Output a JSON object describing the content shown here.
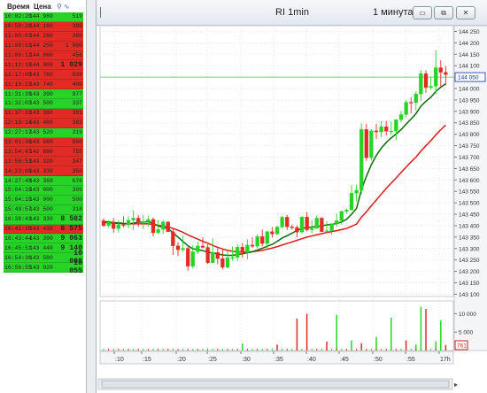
{
  "tape": {
    "header": {
      "time": "Время",
      "price": "Цена"
    },
    "rows": [
      {
        "time": "10:02:20",
        "price": "144 980",
        "qty": "519",
        "side": "buy"
      },
      {
        "time": "10:58:26",
        "price": "144 180",
        "qty": "398",
        "side": "sell"
      },
      {
        "time": "11:09:01",
        "price": "144 260",
        "qty": "380",
        "side": "sell"
      },
      {
        "time": "11:09:01",
        "price": "144 250",
        "qty": "1 000",
        "side": "sell"
      },
      {
        "time": "11:09:12",
        "price": "144 060",
        "qty": "456",
        "side": "sell"
      },
      {
        "time": "11:12:15",
        "price": "144 000",
        "qty": "1 029",
        "side": "sell",
        "big": true
      },
      {
        "time": "11:17:05",
        "price": "143 780",
        "qty": "839",
        "side": "sell"
      },
      {
        "time": "11:19:21",
        "price": "143 740",
        "qty": "409",
        "side": "sell"
      },
      {
        "time": "11:31:39",
        "price": "143 390",
        "qty": "977",
        "side": "buy"
      },
      {
        "time": "11:32:02",
        "price": "143 500",
        "qty": "337",
        "side": "buy"
      },
      {
        "time": "11:37:31",
        "price": "143 360",
        "qty": "381",
        "side": "sell"
      },
      {
        "time": "12:18:14",
        "price": "143 480",
        "qty": "383",
        "side": "sell"
      },
      {
        "time": "12:27:17",
        "price": "143 520",
        "qty": "319",
        "side": "buy"
      },
      {
        "time": "13:01:30",
        "price": "143 080",
        "qty": "500",
        "side": "sell"
      },
      {
        "time": "13:54:47",
        "price": "142 880",
        "qty": "755",
        "side": "sell"
      },
      {
        "time": "13:58:53",
        "price": "143 320",
        "qty": "347",
        "side": "sell"
      },
      {
        "time": "14:23:09",
        "price": "143 330",
        "qty": "350",
        "side": "sell"
      },
      {
        "time": "14:27:48",
        "price": "143 360",
        "qty": "676",
        "side": "buy"
      },
      {
        "time": "15:04:19",
        "price": "143 000",
        "qty": "305",
        "side": "buy"
      },
      {
        "time": "15:04:19",
        "price": "143 000",
        "qty": "500",
        "side": "buy"
      },
      {
        "time": "15:49:57",
        "price": "143 500",
        "qty": "318",
        "side": "buy"
      },
      {
        "time": "16:39:41",
        "price": "143 330",
        "qty": "8 582",
        "side": "buy",
        "big": true
      },
      {
        "time": "16:41:26",
        "price": "143 430",
        "qty": "8 575",
        "side": "sell",
        "big": true
      },
      {
        "time": "16:43:44",
        "price": "143 390",
        "qty": "9 063",
        "side": "buy",
        "big": true
      },
      {
        "time": "16:45:51",
        "price": "143 440",
        "qty": "9 140",
        "side": "buy",
        "big": true
      },
      {
        "time": "16:54:36",
        "price": "143 580",
        "qty": "10 008",
        "side": "buy",
        "big": true
      },
      {
        "time": "16:56:55",
        "price": "143 920",
        "qty": "10 055",
        "side": "buy",
        "big": true
      }
    ]
  },
  "window": {
    "title": "RI 1min",
    "timeframe": "1 минута",
    "buttons": {
      "minimize": "▭",
      "restore": "⧉",
      "close": "✕"
    }
  },
  "colors": {
    "buy": "#27d327",
    "sell": "#e22b25",
    "ma_fast": "#0b6b0b",
    "ma_slow": "#e01818",
    "last_line": "#33cc33"
  },
  "chart_data": {
    "type": "candlestick",
    "instrument": "RI",
    "ylim": [
      143090,
      144275
    ],
    "y_ticks": [
      "144 250",
      "144 200",
      "144 150",
      "144 100",
      "144 050",
      "144 000",
      "143 950",
      "143 900",
      "143 850",
      "143 800",
      "143 750",
      "143 700",
      "143 650",
      "143 600",
      "143 550",
      "143 500",
      "143 450",
      "143 400",
      "143 350",
      "143 300",
      "143 250",
      "143 200",
      "143 150",
      "143 100"
    ],
    "last_price": "144 050",
    "x_ticks": [
      ":10",
      ":15",
      ":20",
      ":25",
      ":30",
      ":35",
      ":40",
      ":45",
      ":50",
      ":55",
      "17h"
    ],
    "candles_ohlc": [
      [
        143422,
        143432,
        143394,
        143400
      ],
      [
        143400,
        143424,
        143391,
        143414
      ],
      [
        143414,
        143433,
        143369,
        143387
      ],
      [
        143387,
        143424,
        143371,
        143405
      ],
      [
        143405,
        143441,
        143393,
        143403
      ],
      [
        143403,
        143441,
        143389,
        143424
      ],
      [
        143424,
        143467,
        143381,
        143433
      ],
      [
        143433,
        143447,
        143394,
        143414
      ],
      [
        143414,
        143447,
        143386,
        143418
      ],
      [
        143418,
        143444,
        143395,
        143427
      ],
      [
        143427,
        143436,
        143353,
        143369
      ],
      [
        143369,
        143425,
        143363,
        143383
      ],
      [
        143383,
        143426,
        143364,
        143416
      ],
      [
        143416,
        143419,
        143373,
        143374
      ],
      [
        143374,
        143384,
        143272,
        143312
      ],
      [
        143312,
        143328,
        143267,
        143295
      ],
      [
        143295,
        143356,
        143285,
        143301
      ],
      [
        143301,
        143307,
        143203,
        143223
      ],
      [
        143223,
        143314,
        143213,
        143286
      ],
      [
        143286,
        143331,
        143276,
        143311
      ],
      [
        143311,
        143349,
        143300,
        143305
      ],
      [
        143305,
        143318,
        143233,
        143238
      ],
      [
        143238,
        143344,
        143237,
        143283
      ],
      [
        143283,
        143303,
        143231,
        143256
      ],
      [
        143256,
        143300,
        143209,
        143218
      ],
      [
        143218,
        143290,
        143213,
        143259
      ],
      [
        143259,
        143308,
        143247,
        143261
      ],
      [
        143261,
        143317,
        143246,
        143306
      ],
      [
        143306,
        143324,
        143260,
        143282
      ],
      [
        143282,
        143340,
        143253,
        143315
      ],
      [
        143315,
        143350,
        143303,
        143310
      ],
      [
        143310,
        143361,
        143301,
        143352
      ],
      [
        143352,
        143383,
        143309,
        143322
      ],
      [
        143322,
        143378,
        143298,
        143374
      ],
      [
        143374,
        143394,
        143348,
        143364
      ],
      [
        143364,
        143400,
        143358,
        143394
      ],
      [
        143394,
        143442,
        143388,
        143437
      ],
      [
        143437,
        143447,
        143381,
        143395
      ],
      [
        143395,
        143405,
        143383,
        143392
      ],
      [
        143392,
        143402,
        143349,
        143372
      ],
      [
        143372,
        143442,
        143366,
        143438
      ],
      [
        143438,
        143459,
        143375,
        143382
      ],
      [
        143382,
        143423,
        143366,
        143388
      ],
      [
        143388,
        143445,
        143387,
        143433
      ],
      [
        143433,
        143437,
        143372,
        143374
      ],
      [
        143374,
        143420,
        143364,
        143378
      ],
      [
        143378,
        143410,
        143361,
        143409
      ],
      [
        143409,
        143453,
        143396,
        143422
      ],
      [
        143422,
        143465,
        143405,
        143463
      ],
      [
        143463,
        143475,
        143452,
        143469
      ],
      [
        143469,
        143577,
        143467,
        143542
      ],
      [
        143542,
        143580,
        143505,
        143555
      ],
      [
        143555,
        143848,
        143538,
        143821
      ],
      [
        143821,
        143845,
        143683,
        143697
      ],
      [
        143697,
        143822,
        143685,
        143815
      ],
      [
        143815,
        143845,
        143780,
        143810
      ],
      [
        143810,
        143858,
        143787,
        143833
      ],
      [
        143833,
        143859,
        143795,
        143813
      ],
      [
        143813,
        143856,
        143797,
        143814
      ],
      [
        143814,
        143863,
        143774,
        143864
      ],
      [
        143864,
        143902,
        143851,
        143886
      ],
      [
        143886,
        143949,
        143874,
        143940
      ],
      [
        143940,
        143963,
        143891,
        143938
      ],
      [
        143938,
        143987,
        143904,
        143976
      ],
      [
        143976,
        144080,
        143946,
        144065
      ],
      [
        144065,
        144080,
        143981,
        144004
      ],
      [
        144004,
        144052,
        143994,
        144010
      ],
      [
        144010,
        144166,
        143975,
        144091
      ],
      [
        144091,
        144123,
        144007,
        144071
      ],
      [
        144071,
        144098,
        144014,
        144061
      ]
    ],
    "ma_fast": [
      143418,
      143416,
      143414,
      143412,
      143410,
      143408,
      143411,
      143416,
      143415,
      143418,
      143410,
      143398,
      143393,
      143387,
      143369,
      143350,
      143331,
      143312,
      143299,
      143295,
      143291,
      143284,
      143281,
      143276,
      143272,
      143270,
      143270,
      143274,
      143277,
      143281,
      143286,
      143293,
      143301,
      143310,
      143318,
      143331,
      143346,
      143356,
      143367,
      143379,
      143388,
      143391,
      143394,
      143396,
      143400,
      143403,
      143406,
      143409,
      143416,
      143428,
      143450,
      143475,
      143557,
      143616,
      143667,
      143707,
      143739,
      143764,
      143784,
      143801,
      143820,
      143844,
      143866,
      143890,
      143923,
      143944,
      143962,
      143987,
      144006,
      144021
    ],
    "ma_slow": [
      143414,
      143413,
      143411,
      143410,
      143409,
      143408,
      143408,
      143408,
      143408,
      143408,
      143405,
      143402,
      143399,
      143395,
      143388,
      143380,
      143371,
      143360,
      143350,
      143341,
      143332,
      143323,
      143314,
      143305,
      143298,
      143292,
      143288,
      143285,
      143284,
      143284,
      143286,
      143289,
      143292,
      143297,
      143302,
      143308,
      143315,
      143322,
      143329,
      143336,
      143343,
      143350,
      143355,
      143360,
      143365,
      143370,
      143374,
      143378,
      143383,
      143388,
      143397,
      143407,
      143437,
      143461,
      143487,
      143512,
      143538,
      143563,
      143586,
      143609,
      143633,
      143656,
      143679,
      143700,
      143726,
      143750,
      143772,
      143797,
      143820,
      143840
    ],
    "volume_ticks": [
      "10 000",
      "5 000"
    ],
    "volume_last": "761",
    "volumes": [
      {
        "i": 28,
        "v": 1900,
        "side": "buy"
      },
      {
        "i": 35,
        "v": 1600,
        "side": "sell"
      },
      {
        "i": 39,
        "v": 8700,
        "side": "sell"
      },
      {
        "i": 41,
        "v": 10000,
        "side": "sell"
      },
      {
        "i": 45,
        "v": 2400,
        "side": "sell"
      },
      {
        "i": 47,
        "v": 9700,
        "side": "buy"
      },
      {
        "i": 50,
        "v": 2700,
        "side": "buy"
      },
      {
        "i": 52,
        "v": 2000,
        "side": "sell"
      },
      {
        "i": 55,
        "v": 3700,
        "side": "buy"
      },
      {
        "i": 58,
        "v": 8900,
        "side": "buy"
      },
      {
        "i": 61,
        "v": 2700,
        "side": "sell"
      },
      {
        "i": 63,
        "v": 1600,
        "side": "buy"
      },
      {
        "i": 64,
        "v": 11900,
        "side": "buy"
      },
      {
        "i": 65,
        "v": 11300,
        "side": "sell"
      },
      {
        "i": 67,
        "v": 2500,
        "side": "buy"
      },
      {
        "i": 68,
        "v": 8200,
        "side": "buy"
      },
      {
        "i": 69,
        "v": 1500,
        "side": "sell"
      }
    ]
  }
}
